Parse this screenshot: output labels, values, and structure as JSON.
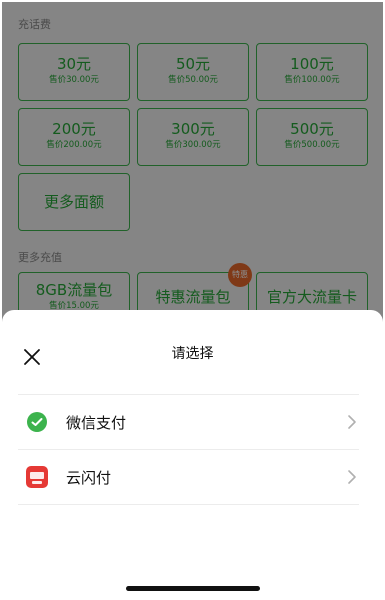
{
  "background": {
    "recharge_section_title": "充话费",
    "tiles": [
      {
        "amount": "30元",
        "price": "售价30.00元"
      },
      {
        "amount": "50元",
        "price": "售价50.00元"
      },
      {
        "amount": "100元",
        "price": "售价100.00元"
      },
      {
        "amount": "200元",
        "price": "售价200.00元"
      },
      {
        "amount": "300元",
        "price": "售价300.00元"
      },
      {
        "amount": "500元",
        "price": "售价500.00元"
      }
    ],
    "more_amount_label": "更多面额",
    "more_recharge_title": "更多充值",
    "data_tiles": [
      {
        "label": "8GB流量包",
        "price": "售价15.00元"
      },
      {
        "label": "特惠流量包",
        "badge": "特惠"
      },
      {
        "label": "官方大流量卡"
      }
    ]
  },
  "sheet": {
    "title": "请选择",
    "options": [
      {
        "label": "微信支付",
        "icon": "wechat-pay-icon"
      },
      {
        "label": "云闪付",
        "icon": "unionpay-cloud-icon"
      }
    ]
  },
  "colors": {
    "accent_green": "#3cb34d",
    "badge_orange": "#e8692a",
    "unionpay_red": "#e53935"
  }
}
